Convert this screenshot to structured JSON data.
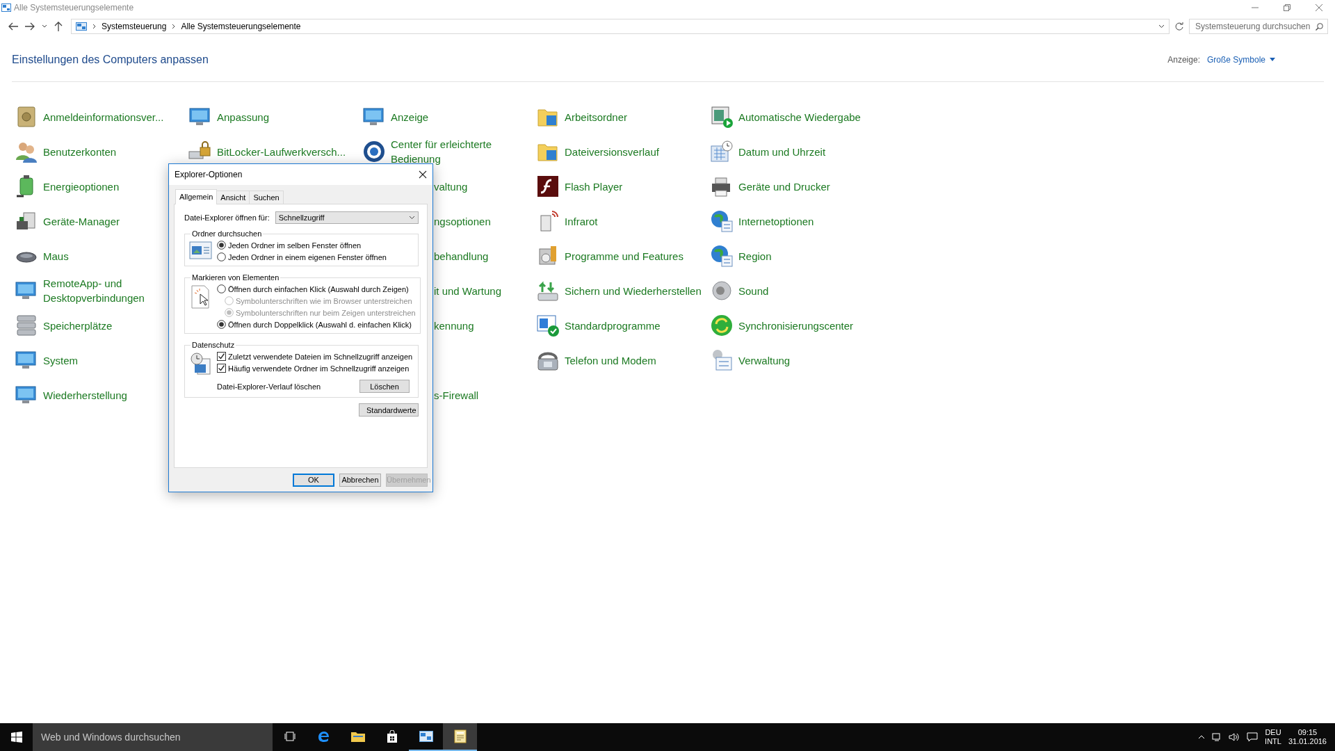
{
  "window": {
    "title": "Alle Systemsteuerungselemente"
  },
  "address_bar": {
    "breadcrumbs": [
      "Systemsteuerung",
      "Alle Systemsteuerungselemente"
    ]
  },
  "search": {
    "placeholder": "Systemsteuerung durchsuchen"
  },
  "heading": "Einstellungen des Computers anpassen",
  "view": {
    "label": "Anzeige:",
    "value": "Große Symbole"
  },
  "columns": [
    [
      {
        "kind": "item",
        "label": "Anmeldeinformationsver..."
      },
      {
        "kind": "item",
        "label": "Benutzerkonten"
      },
      {
        "kind": "item",
        "label": "Energieoptionen"
      },
      {
        "kind": "item",
        "label": "Geräte-Manager"
      },
      {
        "kind": "item",
        "label": "Maus"
      },
      {
        "kind": "item",
        "label": "RemoteApp- und Desktopverbindungen"
      },
      {
        "kind": "item",
        "label": "Speicherplätze"
      },
      {
        "kind": "item",
        "label": "System"
      },
      {
        "kind": "item",
        "label": "Wiederherstellung"
      }
    ],
    [
      {
        "kind": "item",
        "label": "Anpassung"
      },
      {
        "kind": "item",
        "label": "BitLocker-Laufwerkversch..."
      }
    ],
    [
      {
        "kind": "item",
        "label": "Anzeige"
      },
      {
        "kind": "item",
        "label": "Center für erleichterte Bedienung"
      },
      {
        "kind": "partial",
        "label": "valtung"
      },
      {
        "kind": "partial",
        "label": "ngsoptionen"
      },
      {
        "kind": "partial",
        "label": "behandlung"
      },
      {
        "kind": "partial",
        "label": "it und Wartung"
      },
      {
        "kind": "partial",
        "label": "kennung"
      },
      null,
      {
        "kind": "partial",
        "label": "s-Firewall"
      }
    ],
    [
      {
        "kind": "item",
        "label": "Arbeitsordner"
      },
      {
        "kind": "item",
        "label": "Dateiversionsverlauf"
      },
      {
        "kind": "item",
        "label": "Flash Player"
      },
      {
        "kind": "item",
        "label": "Infrarot"
      },
      {
        "kind": "item",
        "label": "Programme und Features"
      },
      {
        "kind": "item",
        "label": "Sichern und Wiederherstellen"
      },
      {
        "kind": "item",
        "label": "Standardprogramme"
      },
      {
        "kind": "item",
        "label": "Telefon und Modem"
      }
    ],
    [
      {
        "kind": "item",
        "label": "Automatische Wiedergabe"
      },
      {
        "kind": "item",
        "label": "Datum und Uhrzeit"
      },
      {
        "kind": "item",
        "label": "Geräte und Drucker"
      },
      {
        "kind": "item",
        "label": "Internetoptionen"
      },
      {
        "kind": "item",
        "label": "Region"
      },
      {
        "kind": "item",
        "label": "Sound"
      },
      {
        "kind": "item",
        "label": "Synchronisierungscenter"
      },
      {
        "kind": "item",
        "label": "Verwaltung"
      }
    ]
  ],
  "dialog": {
    "title": "Explorer-Optionen",
    "tabs": [
      {
        "label": "Allgemein",
        "selected": true
      },
      {
        "label": "Ansicht",
        "selected": false
      },
      {
        "label": "Suchen",
        "selected": false
      }
    ],
    "open_for": {
      "label": "Datei-Explorer öffnen für:",
      "value": "Schnellzugriff"
    },
    "groups": [
      {
        "title": "Ordner durchsuchen",
        "options": [
          {
            "kind": "radio",
            "label": "Jeden Ordner im selben Fenster öffnen",
            "selected": true,
            "disabled": false
          },
          {
            "kind": "radio",
            "label": "Jeden Ordner in einem eigenen Fenster öffnen",
            "selected": false,
            "disabled": false
          }
        ]
      },
      {
        "title": "Markieren von Elementen",
        "options": [
          {
            "kind": "radio",
            "label": "Öffnen durch einfachen Klick (Auswahl durch Zeigen)",
            "selected": false,
            "disabled": false,
            "children": [
              {
                "kind": "radio",
                "label": "Symbolunterschriften wie im Browser unterstreichen",
                "selected": false,
                "disabled": true
              },
              {
                "kind": "radio",
                "label": "Symbolunterschriften nur beim Zeigen unterstreichen",
                "selected": true,
                "disabled": true
              }
            ]
          },
          {
            "kind": "radio",
            "label": "Öffnen durch Doppelklick (Auswahl d. einfachen Klick)",
            "selected": true,
            "disabled": false
          }
        ]
      },
      {
        "title": "Datenschutz",
        "options": [
          {
            "kind": "checkbox",
            "label": "Zuletzt verwendete Dateien im Schnellzugriff anzeigen",
            "checked": true
          },
          {
            "kind": "checkbox",
            "label": "Häufig verwendete Ordner im Schnellzugriff anzeigen",
            "checked": true
          }
        ],
        "clear": {
          "label": "Datei-Explorer-Verlauf löschen",
          "button": "Löschen"
        }
      }
    ],
    "defaults_button": "Standardwerte",
    "buttons": [
      {
        "label": "OK",
        "default": true,
        "disabled": false
      },
      {
        "label": "Abbrechen",
        "default": false,
        "disabled": false
      },
      {
        "label": "Übernehmen",
        "default": false,
        "disabled": true
      }
    ]
  },
  "taskbar": {
    "search_placeholder": "Web und Windows durchsuchen",
    "apps": [
      {
        "running": false,
        "selected": false
      },
      {
        "running": false,
        "selected": false
      },
      {
        "running": false,
        "selected": false
      },
      {
        "running": false,
        "selected": false
      },
      {
        "running": true,
        "selected": false
      },
      {
        "running": true,
        "selected": true
      }
    ],
    "language": [
      "DEU",
      "INTL"
    ],
    "time": "09:15",
    "date": "31.01.2016"
  }
}
